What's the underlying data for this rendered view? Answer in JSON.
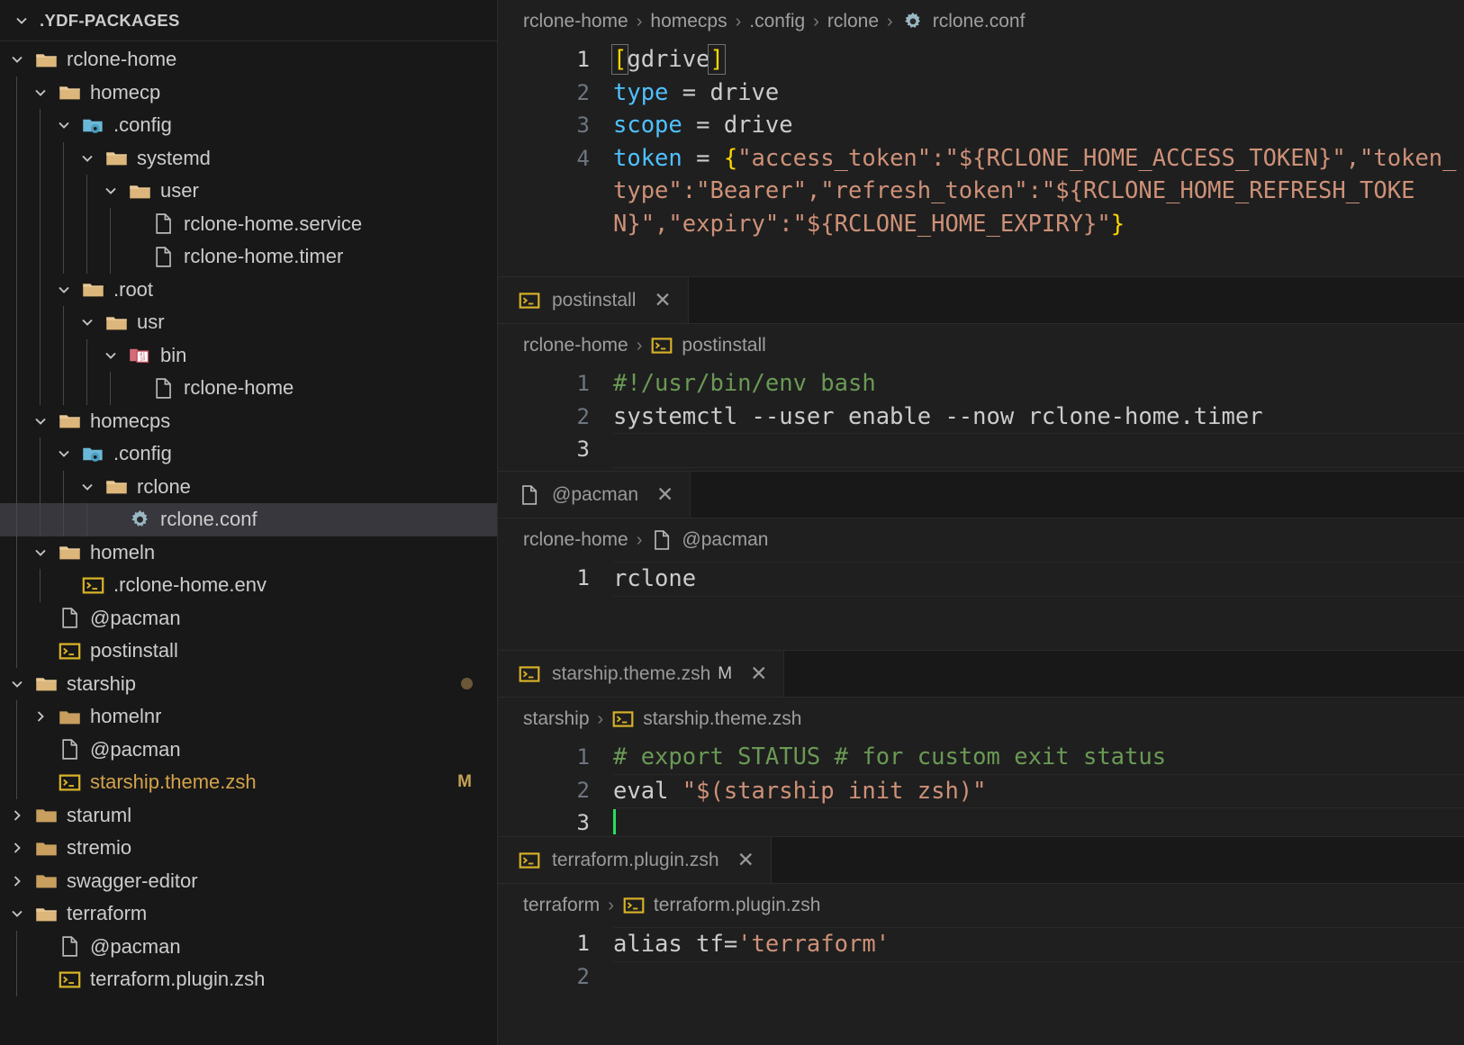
{
  "sidebar": {
    "title": ".YDF-PACKAGES",
    "items": [
      {
        "label": "rclone-home",
        "depth": 1,
        "kind": "folder",
        "state": "expanded"
      },
      {
        "label": "homecp",
        "depth": 2,
        "kind": "folder",
        "state": "expanded"
      },
      {
        "label": ".config",
        "depth": 3,
        "kind": "config",
        "state": "expanded"
      },
      {
        "label": "systemd",
        "depth": 4,
        "kind": "folder",
        "state": "expanded"
      },
      {
        "label": "user",
        "depth": 5,
        "kind": "folder",
        "state": "expanded"
      },
      {
        "label": "rclone-home.service",
        "depth": 6,
        "kind": "file",
        "state": "leaf"
      },
      {
        "label": "rclone-home.timer",
        "depth": 6,
        "kind": "file",
        "state": "leaf"
      },
      {
        "label": ".root",
        "depth": 3,
        "kind": "folder",
        "state": "expanded"
      },
      {
        "label": "usr",
        "depth": 4,
        "kind": "folder",
        "state": "expanded"
      },
      {
        "label": "bin",
        "depth": 5,
        "kind": "binary",
        "state": "expanded"
      },
      {
        "label": "rclone-home",
        "depth": 6,
        "kind": "file",
        "state": "leaf"
      },
      {
        "label": "homecps",
        "depth": 2,
        "kind": "folder",
        "state": "expanded"
      },
      {
        "label": ".config",
        "depth": 3,
        "kind": "config",
        "state": "expanded"
      },
      {
        "label": "rclone",
        "depth": 4,
        "kind": "folder",
        "state": "expanded"
      },
      {
        "label": "rclone.conf",
        "depth": 5,
        "kind": "gear",
        "state": "leaf",
        "selected": true
      },
      {
        "label": "homeln",
        "depth": 2,
        "kind": "folder",
        "state": "expanded"
      },
      {
        "label": ".rclone-home.env",
        "depth": 3,
        "kind": "shell",
        "state": "leaf"
      },
      {
        "label": "@pacman",
        "depth": 2,
        "kind": "file",
        "state": "leaf"
      },
      {
        "label": "postinstall",
        "depth": 2,
        "kind": "shell",
        "state": "leaf"
      },
      {
        "label": "starship",
        "depth": 1,
        "kind": "folder",
        "state": "expanded",
        "dot": true
      },
      {
        "label": "homelnr",
        "depth": 2,
        "kind": "folder",
        "state": "collapsed"
      },
      {
        "label": "@pacman",
        "depth": 2,
        "kind": "file",
        "state": "leaf"
      },
      {
        "label": "starship.theme.zsh",
        "depth": 2,
        "kind": "shell",
        "state": "leaf",
        "modified": true,
        "badge": "M"
      },
      {
        "label": "staruml",
        "depth": 1,
        "kind": "folder",
        "state": "collapsed"
      },
      {
        "label": "stremio",
        "depth": 1,
        "kind": "folder",
        "state": "collapsed"
      },
      {
        "label": "swagger-editor",
        "depth": 1,
        "kind": "folder",
        "state": "collapsed"
      },
      {
        "label": "terraform",
        "depth": 1,
        "kind": "folder",
        "state": "expanded"
      },
      {
        "label": "@pacman",
        "depth": 2,
        "kind": "file",
        "state": "leaf"
      },
      {
        "label": "terraform.plugin.zsh",
        "depth": 2,
        "kind": "shell",
        "state": "leaf"
      }
    ]
  },
  "editor_groups": [
    {
      "id": "rclone-conf",
      "tab": null,
      "breadcrumb": [
        {
          "text": "rclone-home",
          "icon": null
        },
        {
          "text": "homecps",
          "icon": null
        },
        {
          "text": ".config",
          "icon": null
        },
        {
          "text": "rclone",
          "icon": null
        },
        {
          "text": "rclone.conf",
          "icon": "gear"
        }
      ],
      "lines": [
        {
          "num": "1",
          "active": true,
          "segments": [
            {
              "text": "[",
              "cls": "t-bracket"
            },
            {
              "text": "gdrive",
              "cls": "t-plain"
            },
            {
              "text": "]",
              "cls": "t-bracket"
            }
          ]
        },
        {
          "num": "2",
          "active": false,
          "segments": [
            {
              "text": "type",
              "cls": "t-key"
            },
            {
              "text": " = ",
              "cls": "t-op"
            },
            {
              "text": "drive",
              "cls": "t-plain"
            }
          ]
        },
        {
          "num": "3",
          "active": false,
          "segments": [
            {
              "text": "scope",
              "cls": "t-key"
            },
            {
              "text": " = ",
              "cls": "t-op"
            },
            {
              "text": "drive",
              "cls": "t-plain"
            }
          ]
        },
        {
          "num": "4",
          "active": false,
          "wrap": true,
          "segments": [
            {
              "text": "token",
              "cls": "t-key"
            },
            {
              "text": " = ",
              "cls": "t-op"
            },
            {
              "text": "{",
              "cls": "t-brace-y"
            },
            {
              "text": "\"access_token\":\"${RCLONE_HOME_ACCESS_TOKEN}\",\"token_type\":\"Bearer\",\"refresh_token\":\"${RCLONE_HOME_REFRESH_TOKEN}\",\"expiry\":\"${RCLONE_HOME_EXPIRY}\"",
              "cls": "t-str"
            },
            {
              "text": "}",
              "cls": "t-brace-y"
            }
          ]
        }
      ]
    },
    {
      "id": "postinstall",
      "tab": {
        "label": "postinstall",
        "icon": "shell",
        "close": "✕",
        "dirty": null
      },
      "breadcrumb": [
        {
          "text": "rclone-home",
          "icon": null
        },
        {
          "text": "postinstall",
          "icon": "shell"
        }
      ],
      "lines": [
        {
          "num": "1",
          "active": false,
          "segments": [
            {
              "text": "#!/usr/bin/env bash",
              "cls": "t-comment"
            }
          ]
        },
        {
          "num": "2",
          "active": false,
          "segments": [
            {
              "text": "systemctl --user enable --now rclone-home.timer",
              "cls": "t-plain"
            }
          ]
        },
        {
          "num": "3",
          "active": true,
          "current": true,
          "segments": []
        }
      ]
    },
    {
      "id": "pacman",
      "tab": {
        "label": "@pacman",
        "icon": "file",
        "close": "✕",
        "dirty": null
      },
      "breadcrumb": [
        {
          "text": "rclone-home",
          "icon": null
        },
        {
          "text": "@pacman",
          "icon": "file"
        }
      ],
      "lines": [
        {
          "num": "1",
          "active": true,
          "current": true,
          "segments": [
            {
              "text": "rclone",
              "cls": "t-plain"
            }
          ]
        }
      ]
    },
    {
      "id": "starship-theme",
      "tab": {
        "label": "starship.theme.zsh",
        "icon": "shell",
        "close": "✕",
        "dirty": "M"
      },
      "breadcrumb": [
        {
          "text": "starship",
          "icon": null
        },
        {
          "text": "starship.theme.zsh",
          "icon": "shell"
        }
      ],
      "lines": [
        {
          "num": "1",
          "active": false,
          "segments": [
            {
              "text": "# export STATUS # for custom exit status",
              "cls": "t-comment"
            }
          ]
        },
        {
          "num": "2",
          "active": false,
          "current": true,
          "segments": [
            {
              "text": "eval ",
              "cls": "t-plain"
            },
            {
              "text": "\"$(starship init zsh)\"",
              "cls": "t-str"
            }
          ]
        },
        {
          "num": "3",
          "active": true,
          "cursor": true,
          "segments": []
        }
      ]
    },
    {
      "id": "terraform-plugin",
      "tab": {
        "label": "terraform.plugin.zsh",
        "icon": "shell",
        "close": "✕",
        "dirty": null
      },
      "breadcrumb": [
        {
          "text": "terraform",
          "icon": null
        },
        {
          "text": "terraform.plugin.zsh",
          "icon": "shell"
        }
      ],
      "lines": [
        {
          "num": "1",
          "active": true,
          "current": true,
          "segments": [
            {
              "text": "alias tf=",
              "cls": "t-plain"
            },
            {
              "text": "'terraform'",
              "cls": "t-str"
            }
          ]
        },
        {
          "num": "2",
          "active": false,
          "segments": []
        }
      ]
    }
  ],
  "icons": {
    "folder": "folder-icon",
    "config": "config-folder-icon",
    "binary": "binary-folder-icon",
    "gear": "gear-icon",
    "shell": "shell-script-icon",
    "file": "generic-file-icon",
    "chevron_down": "chevron-down-icon",
    "chevron_right": "chevron-right-icon",
    "close": "close-icon"
  },
  "colors": {
    "sidebar_bg": "#181818",
    "editor_bg": "#1f1f1f",
    "selection": "#37373d",
    "modified": "#d3a24a",
    "string": "#ce9178",
    "keyword": "#4fc1ff",
    "comment": "#6a9955",
    "bracket": "#ffd700",
    "cursor": "#26de60"
  }
}
